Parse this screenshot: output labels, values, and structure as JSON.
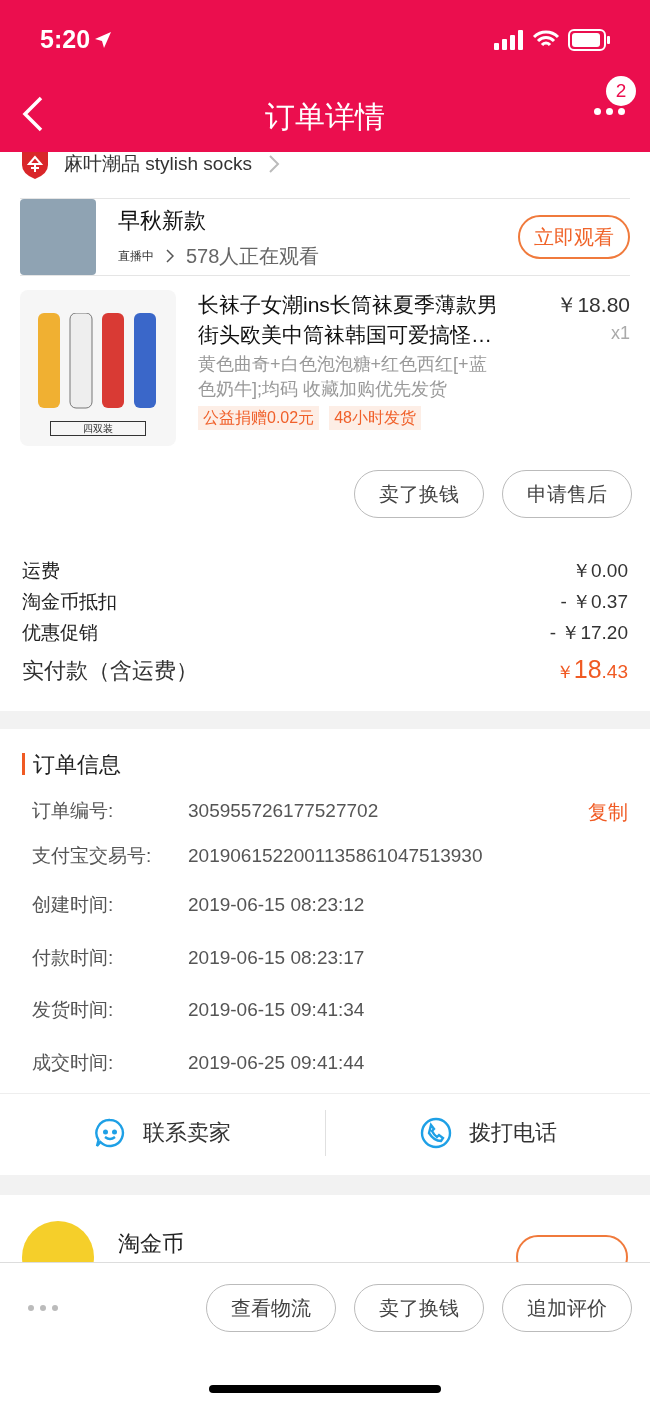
{
  "status_bar": {
    "time": "5:20"
  },
  "nav": {
    "title": "订单详情",
    "badge": "2"
  },
  "shop": {
    "name": "麻叶潮品 stylish socks"
  },
  "live": {
    "title": "早秋新款",
    "status": "直播中",
    "viewers": "578人正在观看",
    "button": "立即观看"
  },
  "product": {
    "title": "长袜子女潮ins长筒袜夏季薄款男街头欧美中筒袜韩国可爱搞怪…",
    "price": "￥18.80",
    "quantity": "x1",
    "spec": "黄色曲奇+白色泡泡糖+红色西红[+蓝色奶牛];均码 收藏加购优先发货",
    "image_caption": "四双装",
    "tags": [
      "公益捐赠0.02元",
      "48小时发货"
    ],
    "actions": [
      "卖了换钱",
      "申请售后"
    ]
  },
  "fees": [
    {
      "label": "运费",
      "value": "￥0.00"
    },
    {
      "label": "淘金币抵扣",
      "value": "- ￥0.37"
    },
    {
      "label": "优惠促销",
      "value": "- ￥17.20"
    }
  ],
  "total": {
    "label": "实付款（含运费）",
    "currency": "￥",
    "integer": "18",
    "decimal": ".43"
  },
  "order_info": {
    "title": "订单信息",
    "copy": "复制",
    "rows": [
      {
        "label": "订单编号:",
        "value": "305955726177527702"
      },
      {
        "label": "支付宝交易号:",
        "value": "2019061522001135861047513930"
      },
      {
        "label": "创建时间:",
        "value": "2019-06-15 08:23:12"
      },
      {
        "label": "付款时间:",
        "value": "2019-06-15 08:23:17"
      },
      {
        "label": "发货时间:",
        "value": "2019-06-15 09:41:34"
      },
      {
        "label": "成交时间:",
        "value": "2019-06-25 09:41:44"
      }
    ]
  },
  "contact": [
    {
      "kind": "chat",
      "label": "联系卖家"
    },
    {
      "kind": "phone",
      "label": "拨打电话"
    }
  ],
  "coins": {
    "title": "淘金币"
  },
  "bottom_actions": [
    "查看物流",
    "卖了换钱",
    "追加评价"
  ]
}
